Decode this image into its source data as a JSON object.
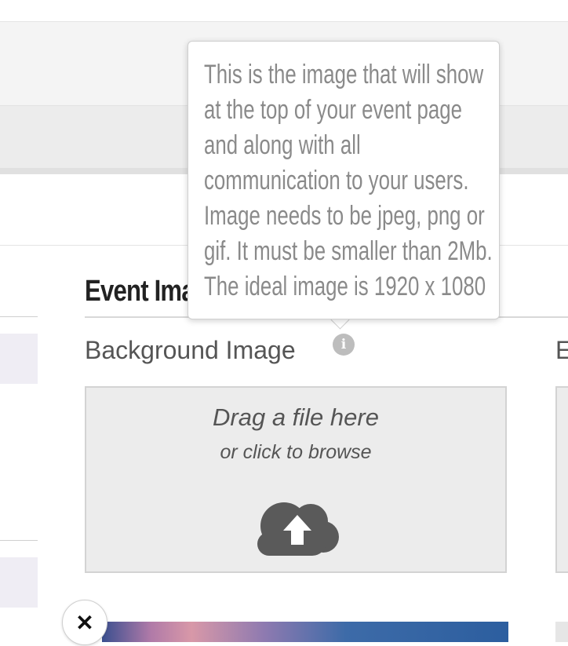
{
  "section": {
    "title": "Event Ima"
  },
  "background_image": {
    "label": "Background Image",
    "info_icon": "info-icon"
  },
  "right_column": {
    "label_partial": "E"
  },
  "dropzone": {
    "main_text": "Drag a file here",
    "sub_text": "or click to browse",
    "icon": "cloud-upload-icon"
  },
  "tooltip": {
    "text": "This is the image that will show at the top of your event page and along with all communication to your users. Image needs to be jpeg, png or gif. It must be smaller than 2Mb. The ideal image is 1920 x 1080"
  },
  "close_button": {
    "label": "✕",
    "icon": "close-icon"
  },
  "colors": {
    "tooltip_text": "#8a8a8a",
    "dropzone_bg": "#ececec",
    "cloud_icon": "#5a5a5a"
  }
}
